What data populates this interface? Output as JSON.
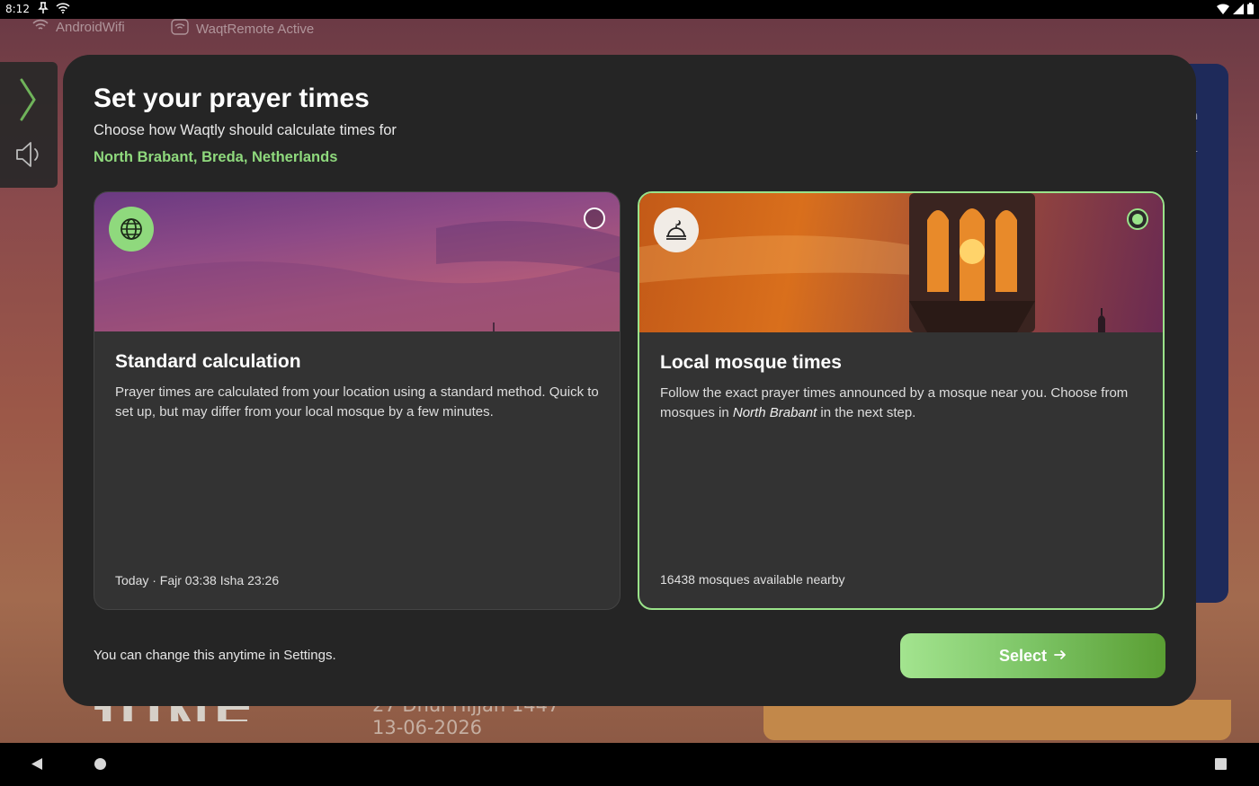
{
  "status_bar": {
    "time": "8:12"
  },
  "background": {
    "network_name": "AndroidWifi",
    "remote_status": "WaqtRemote Active",
    "big_text": "JUNE",
    "hijri_date": "27 Dhul Hijjah 1447",
    "gregorian_date": "13-06-2026",
    "side_text_1": "h",
    "side_text_2": "1"
  },
  "dialog": {
    "title": "Set your prayer times",
    "subtitle": "Choose how Waqtly should calculate times for",
    "location": "North Brabant, Breda, Netherlands",
    "note": "You can change this anytime in Settings.",
    "select_label": "Select",
    "accent_color": "#9ae38a"
  },
  "options": {
    "standard": {
      "title": "Standard calculation",
      "description": "Prayer times are calculated from your location using a standard method. Quick to set up, but may differ from your local mosque by a few minutes.",
      "footer": "Today · Fajr 03:38 Isha 23:26",
      "icon": "globe-icon",
      "selected": false
    },
    "mosque": {
      "title": "Local mosque times",
      "description_pre": "Follow the exact prayer times announced by a mosque near you. Choose from mosques in ",
      "description_region": "North Brabant",
      "description_post": " in the next step.",
      "footer": "16438 mosques available nearby",
      "icon": "mosque-dome-icon",
      "selected": true
    }
  }
}
